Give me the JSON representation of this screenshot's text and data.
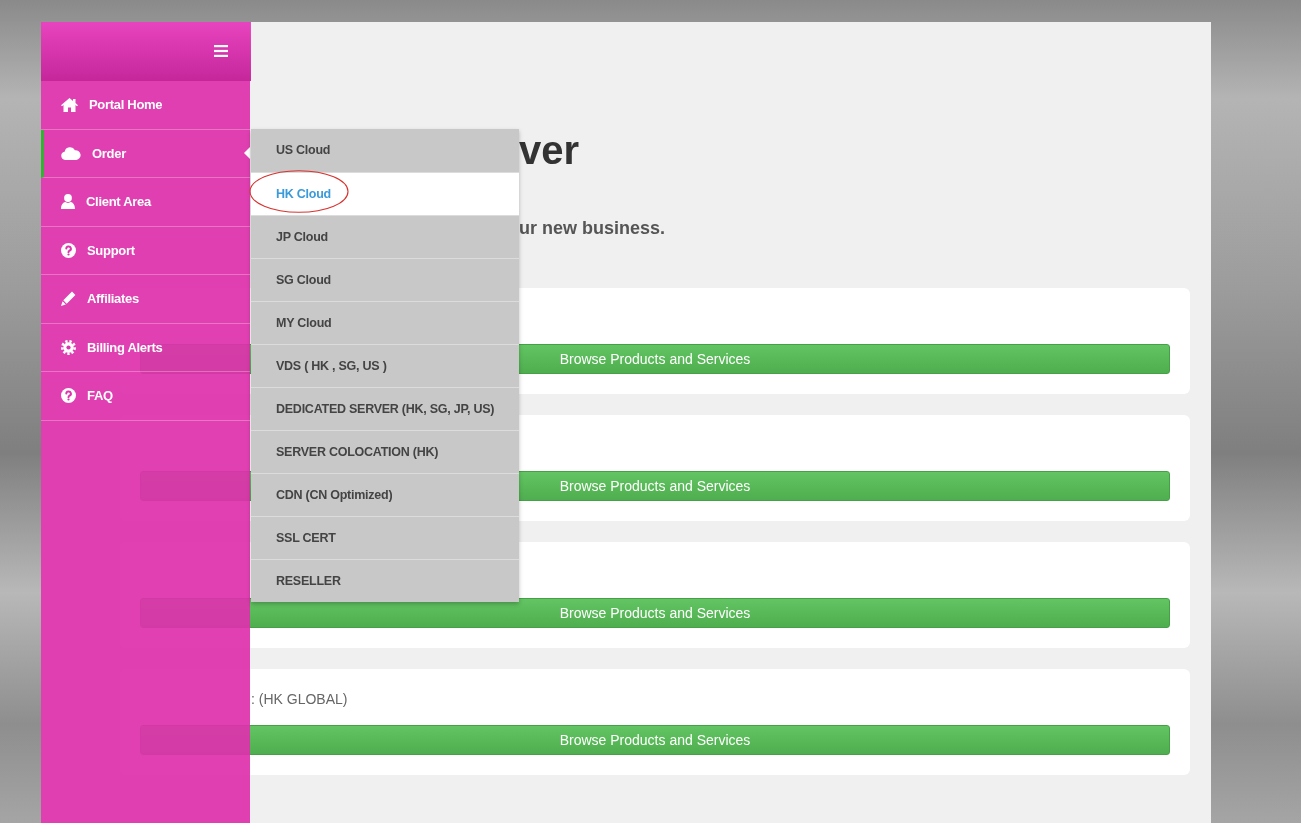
{
  "sidebar": {
    "items": [
      {
        "label": "Portal Home",
        "selected": false,
        "expanded": false
      },
      {
        "label": "Order",
        "selected": true,
        "expanded": true
      },
      {
        "label": "Client Area",
        "selected": false,
        "expanded": false
      },
      {
        "label": "Support",
        "selected": false,
        "expanded": false
      },
      {
        "label": "Affiliates",
        "selected": false,
        "expanded": false
      },
      {
        "label": "Billing Alerts",
        "selected": false,
        "expanded": false
      },
      {
        "label": "FAQ",
        "selected": false,
        "expanded": false
      }
    ]
  },
  "order_menu": {
    "items": [
      {
        "label": "US Cloud",
        "selected": false,
        "circled": false
      },
      {
        "label": "HK Cloud",
        "selected": true,
        "circled": true
      },
      {
        "label": "JP Cloud",
        "selected": false,
        "circled": false
      },
      {
        "label": "SG Cloud",
        "selected": false,
        "circled": false
      },
      {
        "label": "MY Cloud",
        "selected": false,
        "circled": false
      },
      {
        "label": "VDS ( HK , SG, US )",
        "selected": false,
        "circled": false
      },
      {
        "label": "DEDICATED SERVER (HK, SG, JP, US)",
        "selected": false,
        "circled": false
      },
      {
        "label": "SERVER COLOCATION (HK)",
        "selected": false,
        "circled": false
      },
      {
        "label": "CDN (CN Optimized)",
        "selected": false,
        "circled": false
      },
      {
        "label": "SSL CERT",
        "selected": false,
        "circled": false
      },
      {
        "label": "RESELLER",
        "selected": false,
        "circled": false
      }
    ]
  },
  "page": {
    "title": "ver",
    "subtitle": "ur new business."
  },
  "cards": [
    {
      "button": "Browse Products and Services"
    },
    {
      "button": "Browse Products and Services"
    },
    {
      "button": "Browse Products and Services"
    },
    {
      "title": ": (HK GLOBAL)",
      "button": "Browse Products and Services"
    }
  ]
}
